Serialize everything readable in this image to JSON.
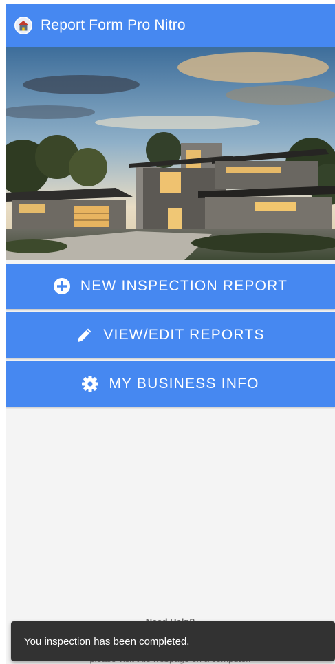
{
  "app": {
    "title": "Report Form Pro Nitro",
    "logo_icon": "house-logo-icon"
  },
  "hero": {
    "image": "modern-house-photo"
  },
  "menu": [
    {
      "label": "NEW INSPECTION REPORT",
      "icon": "plus-circle-icon"
    },
    {
      "label": "VIEW/EDIT REPORTS",
      "icon": "pencil-icon"
    },
    {
      "label": "MY BUSINESS INFO",
      "icon": "gear-icon"
    }
  ],
  "help": {
    "title": "Need Help?",
    "subtitle": "please visit this webpage on a computer."
  },
  "toast": {
    "message": "You inspection has been completed."
  },
  "colors": {
    "primary": "#4688f1",
    "background": "#f4f4f4",
    "toast": "#323232"
  }
}
